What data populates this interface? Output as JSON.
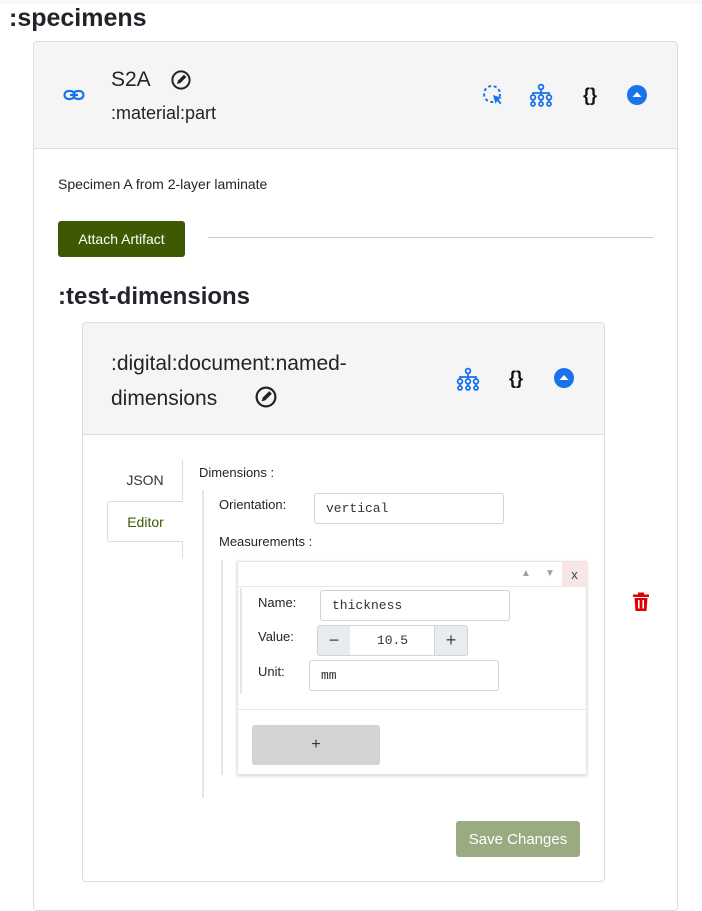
{
  "specimens_heading": ":specimens",
  "specimen": {
    "name": "S2A",
    "type": ":material:part",
    "description": "Specimen A from 2-layer laminate",
    "attach_button": "Attach Artifact"
  },
  "test_dimensions_heading": ":test-dimensions",
  "document": {
    "title": ":digital:document:named-dimensions",
    "tabs": [
      "JSON",
      "Editor"
    ],
    "active_tab": "Editor",
    "dimensions_label": "Dimensions :",
    "orientation_label": "Orientation:",
    "orientation_value": "vertical",
    "measurements_label": "Measurements :",
    "measurement": {
      "move_up": "▲",
      "move_down": "▼",
      "remove": "x",
      "name_label": "Name:",
      "name_value": "thickness",
      "value_label": "Value:",
      "value_value": "10.5",
      "decrement": "−",
      "increment": "+",
      "unit_label": "Unit:",
      "unit_value": "mm"
    },
    "add_item": "+",
    "save_button": "Save Changes"
  },
  "colors": {
    "accent_blue": "#1a73e8",
    "attach_green": "#3d5a03",
    "save_green": "#9aab82",
    "delete_red": "#e00000"
  },
  "icons": [
    "link-icon",
    "edit-icon",
    "select-icon",
    "hierarchy-icon",
    "json-braces-icon",
    "collapse-icon",
    "delete-icon"
  ]
}
